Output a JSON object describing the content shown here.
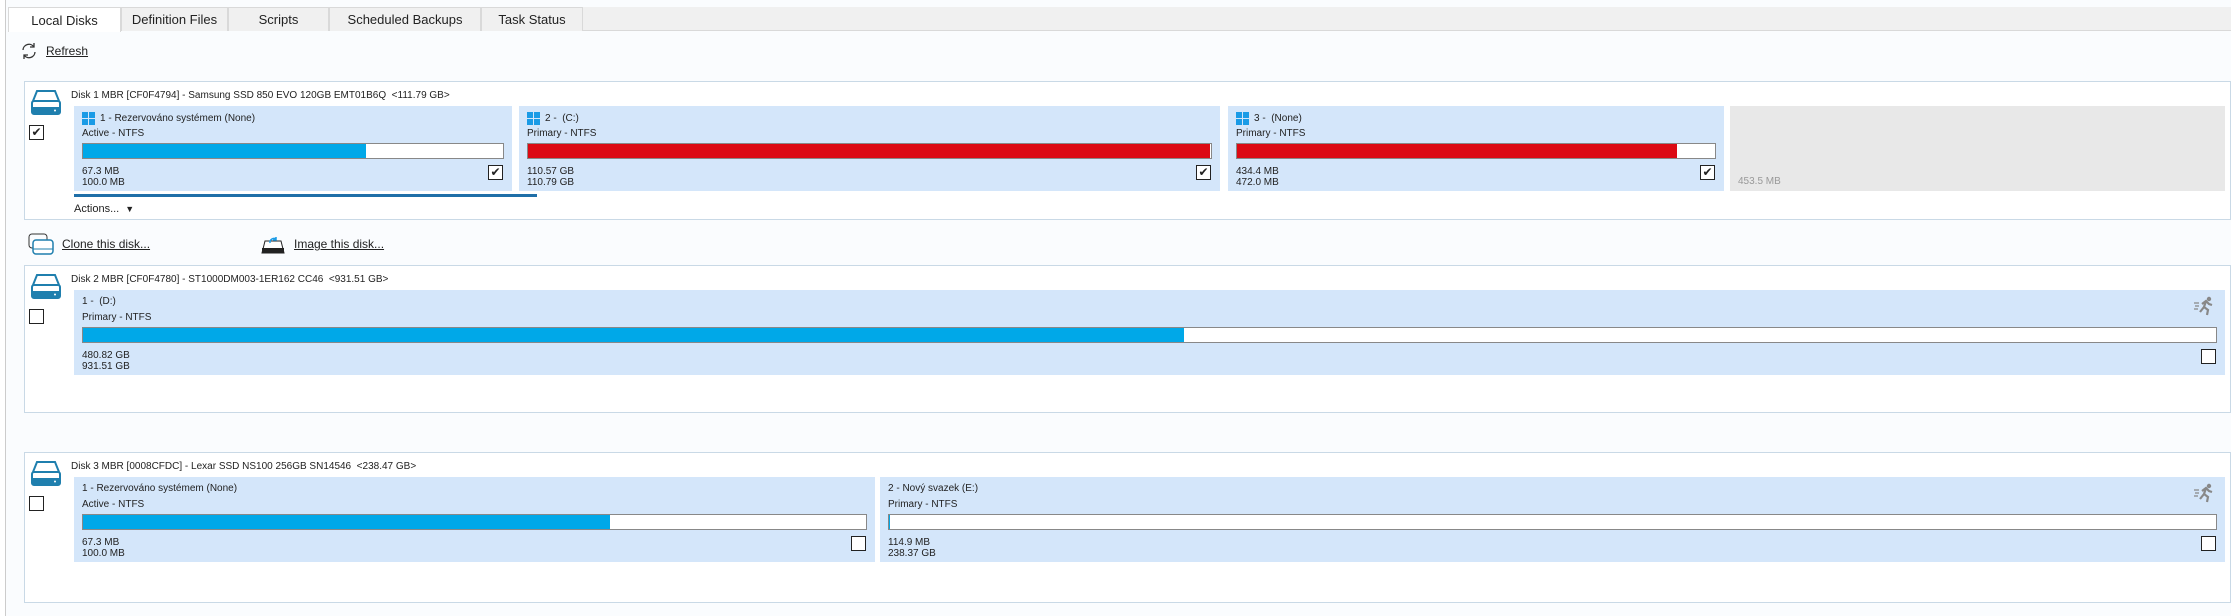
{
  "tabs": [
    {
      "label": "Local Disks",
      "active": true
    },
    {
      "label": "Definition Files"
    },
    {
      "label": "Scripts"
    },
    {
      "label": "Scheduled Backups"
    },
    {
      "label": "Task Status"
    }
  ],
  "toolbar": {
    "refresh": "Refresh",
    "refresh_icon": "refresh-icon"
  },
  "disk_actions": {
    "clone": "Clone this disk...",
    "image": "Image this disk...",
    "actions": "Actions..."
  },
  "colors": {
    "used_normal": "#00a8e8",
    "used_full": "#dc0a14",
    "partition_bg": "#d4e6fa",
    "unallocated_bg": "#e8e8e8"
  },
  "disks": [
    {
      "title": "Disk 1 MBR [CF0F4794] - Samsung SSD 850 EVO 120GB EMT01B6Q  <111.79 GB>",
      "checked": true,
      "partitions": [
        {
          "title": "1 - Rezervováno systémem (None)",
          "type": "Active - NTFS",
          "used": "67.3 MB",
          "total": "100.0 MB",
          "percent": 67.3,
          "color": "#00a8e8",
          "checked": true,
          "windows": true
        },
        {
          "title": "2 -  (C:)",
          "type": "Primary - NTFS",
          "used": "110.57 GB",
          "total": "110.79 GB",
          "percent": 99.8,
          "color": "#dc0a14",
          "checked": true,
          "windows": true
        },
        {
          "title": "3 -  (None)",
          "type": "Primary - NTFS",
          "used": "434.4 MB",
          "total": "472.0 MB",
          "percent": 92,
          "color": "#dc0a14",
          "checked": true,
          "windows": true
        },
        {
          "unallocated": true,
          "size": "453.5 MB"
        }
      ]
    },
    {
      "title": "Disk 2 MBR [CF0F4780] - ST1000DM003-1ER162 CC46  <931.51 GB>",
      "checked": false,
      "partitions": [
        {
          "title": "1 -  (D:)",
          "type": "Primary - NTFS",
          "used": "480.82 GB",
          "total": "931.51 GB",
          "percent": 51.6,
          "color": "#00a8e8",
          "checked": false,
          "runner": true
        }
      ]
    },
    {
      "title": "Disk 3 MBR [0008CFDC] - Lexar SSD NS100 256GB SN14546  <238.47 GB>",
      "checked": false,
      "partitions": [
        {
          "title": "1 - Rezervováno systémem (None)",
          "type": "Active - NTFS",
          "used": "67.3 MB",
          "total": "100.0 MB",
          "percent": 67.3,
          "color": "#00a8e8",
          "checked": false
        },
        {
          "title": "2 - Nový svazek (E:)",
          "type": "Primary - NTFS",
          "used": "114.9 MB",
          "total": "238.37 GB",
          "percent": 0.05,
          "color": "#00a8e8",
          "checked": false,
          "runner": true
        }
      ]
    }
  ]
}
